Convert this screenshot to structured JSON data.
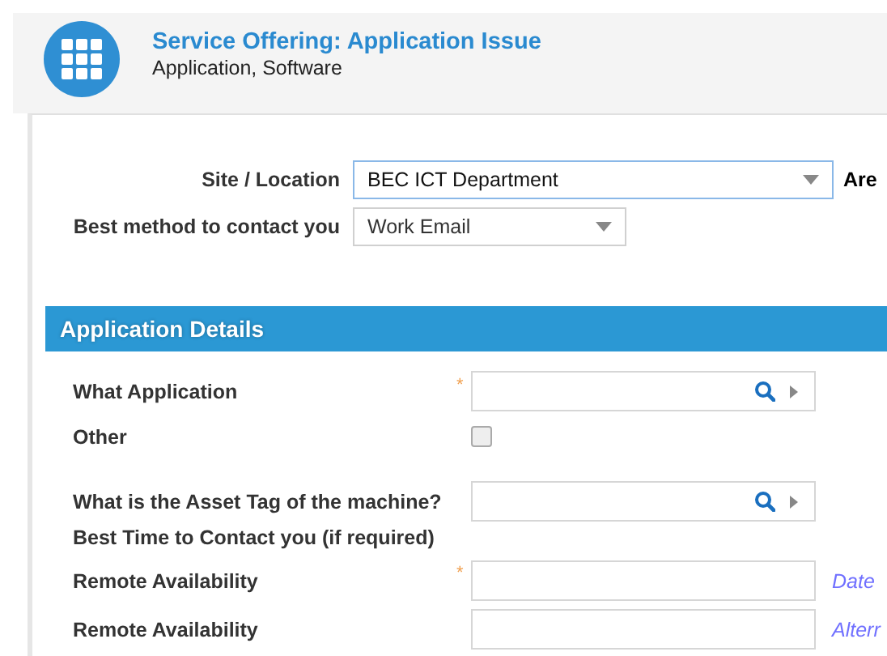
{
  "header": {
    "title": "Service Offering: Application Issue",
    "subtitle": "Application, Software"
  },
  "contact": [
    {
      "label": "Site / Location",
      "value": "BEC ICT Department",
      "focused": true,
      "note": "Are"
    },
    {
      "label": "Best method to contact you",
      "value": "Work Email",
      "focused": false
    }
  ],
  "section": {
    "title": "Application Details"
  },
  "fields": [
    {
      "kind": "lookup",
      "label": "What Application",
      "required_mark": "*"
    },
    {
      "kind": "checkbox",
      "label": "Other",
      "checked": false
    },
    {
      "kind": "lookup",
      "label": "What is the Asset Tag of the machine?"
    },
    {
      "kind": "heading",
      "label": "Best Time to Contact you (if required)"
    },
    {
      "kind": "text",
      "label": "Remote Availability",
      "required_mark": "*",
      "hint": "Date"
    },
    {
      "kind": "text",
      "label": "Remote Availability",
      "hint": "Alterr"
    }
  ]
}
